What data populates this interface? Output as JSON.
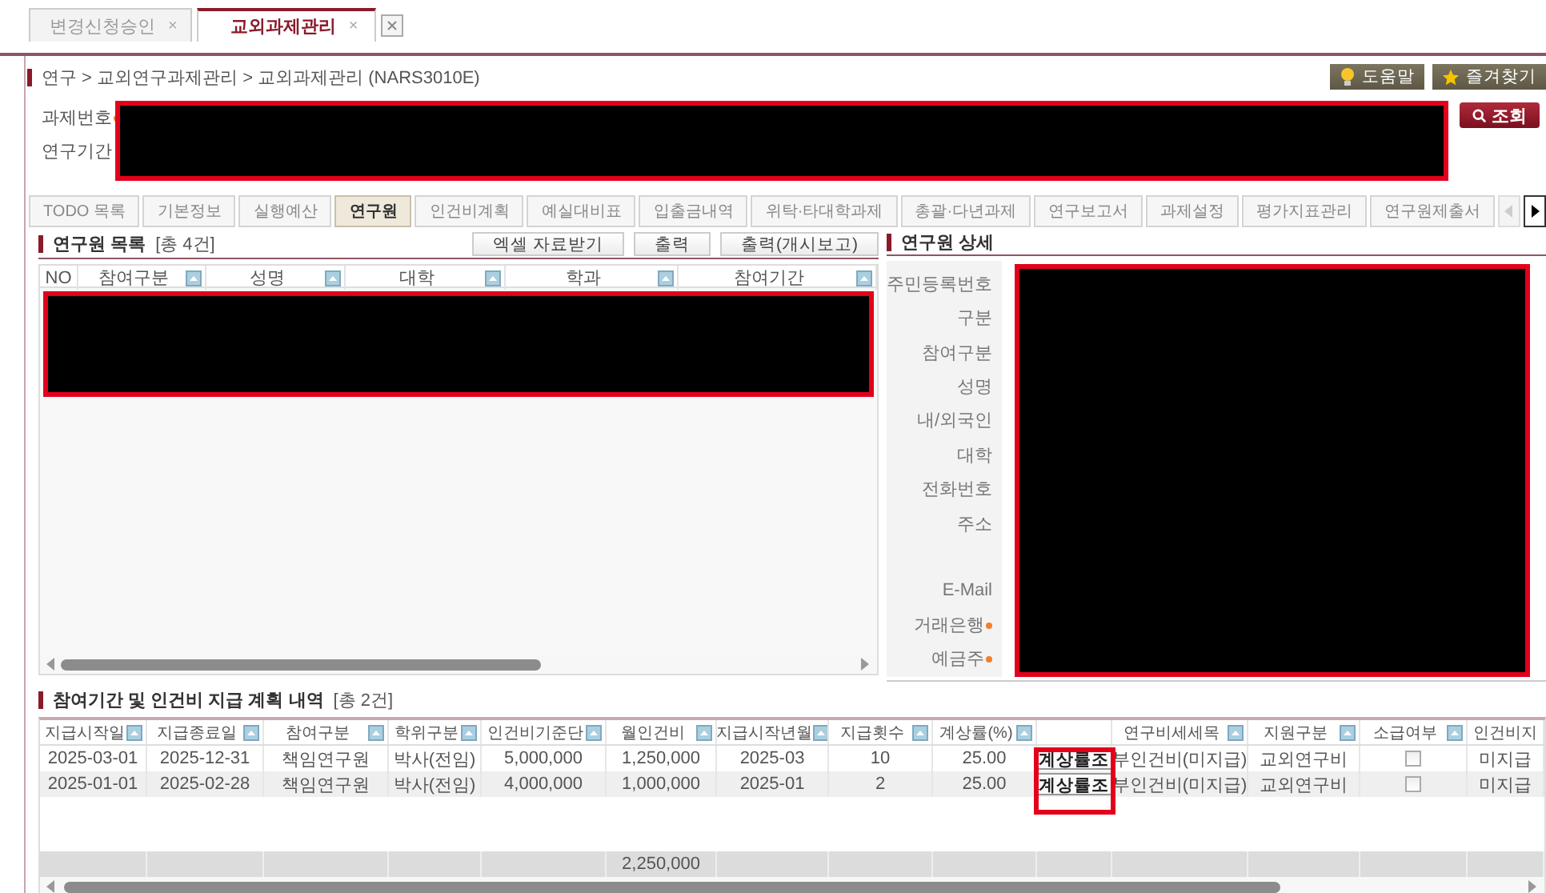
{
  "doc_tabs": [
    {
      "label": "변경신청승인",
      "close": "×",
      "selected": false
    },
    {
      "label": "교외과제관리",
      "close": "×",
      "selected": true
    }
  ],
  "breadcrumb": "연구 > 교외연구과제관리 > 교외과제관리 (NARS3010E)",
  "header_buttons": [
    {
      "kind": "help",
      "label": "도움말"
    },
    {
      "kind": "favorite",
      "label": "즐겨찾기"
    }
  ],
  "search_form": {
    "fields": [
      {
        "label": "과제번호",
        "required": true
      },
      {
        "label": "연구기간",
        "required": false
      }
    ],
    "search_button": "조회"
  },
  "module_tabs": [
    {
      "label": "TODO 목록",
      "selected": false
    },
    {
      "label": "기본정보",
      "selected": false
    },
    {
      "label": "실행예산",
      "selected": false
    },
    {
      "label": "연구원",
      "selected": true
    },
    {
      "label": "인건비계획",
      "selected": false
    },
    {
      "label": "예실대비표",
      "selected": false
    },
    {
      "label": "입출금내역",
      "selected": false
    },
    {
      "label": "위탁·타대학과제",
      "selected": false
    },
    {
      "label": "총괄·다년과제",
      "selected": false
    },
    {
      "label": "연구보고서",
      "selected": false
    },
    {
      "label": "과제설정",
      "selected": false
    },
    {
      "label": "평가지표관리",
      "selected": false
    },
    {
      "label": "연구원제출서",
      "selected": false
    }
  ],
  "researcher_list": {
    "title": "연구원 목록",
    "count": "[총 4건]",
    "buttons": [
      "엑셀 자료받기",
      "출력",
      "출력(개시보고)"
    ],
    "columns": [
      {
        "label": "NO",
        "sortable": false
      },
      {
        "label": "참여구분",
        "sortable": true
      },
      {
        "label": "성명",
        "sortable": true
      },
      {
        "label": "대학",
        "sortable": true
      },
      {
        "label": "학과",
        "sortable": true
      },
      {
        "label": "참여기간",
        "sortable": true
      }
    ]
  },
  "researcher_detail": {
    "title": "연구원 상세",
    "fields": [
      {
        "label": "주민등록번호",
        "required": false
      },
      {
        "label": "구분",
        "required": false
      },
      {
        "label": "참여구분",
        "required": false
      },
      {
        "label": "성명",
        "required": false
      },
      {
        "label": "내/외국인",
        "required": false
      },
      {
        "label": "대학",
        "required": false
      },
      {
        "label": "전화번호",
        "required": false
      },
      {
        "label": "주소",
        "required": false,
        "kind": "tall"
      },
      {
        "label": "E-Mail",
        "required": false
      },
      {
        "label": "거래은행",
        "required": true
      },
      {
        "label": "예금주",
        "required": true
      }
    ]
  },
  "plan": {
    "title": "참여기간 및 인건비 지급 계획 내역",
    "count": "[총 2건]",
    "columns": [
      {
        "label": "지급시작일",
        "sortable": true
      },
      {
        "label": "지급종료일",
        "sortable": true
      },
      {
        "label": "참여구분",
        "sortable": true
      },
      {
        "label": "학위구분",
        "sortable": true
      },
      {
        "label": "인건비기준단",
        "sortable": true
      },
      {
        "label": "월인건비",
        "sortable": true
      },
      {
        "label": "지급시작년월",
        "sortable": true
      },
      {
        "label": "지급횟수",
        "sortable": true
      },
      {
        "label": "계상률(%)",
        "sortable": true
      },
      {
        "sortable": false
      },
      {
        "label": "연구비세세목",
        "sortable": true
      },
      {
        "label": "지원구분",
        "sortable": true
      },
      {
        "label": "소급여부",
        "sortable": true
      },
      {
        "label": "인건비지",
        "sortable": false
      }
    ],
    "rows": [
      {
        "cells": [
          {
            "kind": "text",
            "text": "2025-03-01"
          },
          {
            "kind": "text",
            "text": "2025-12-31"
          },
          {
            "kind": "text",
            "text": "책임연구원"
          },
          {
            "kind": "text",
            "text": "박사(전임)"
          },
          {
            "kind": "text",
            "text": "5,000,000"
          },
          {
            "kind": "text",
            "text": "1,250,000"
          },
          {
            "kind": "text",
            "text": "2025-03"
          },
          {
            "kind": "text",
            "text": "10"
          },
          {
            "kind": "text",
            "text": "25.00"
          },
          {
            "kind": "button",
            "text": "계상률조"
          },
          {
            "kind": "text",
            "text": "부인건비(미지급)"
          },
          {
            "kind": "text",
            "text": "교외연구비"
          },
          {
            "kind": "checkbox",
            "checked": false
          },
          {
            "kind": "text",
            "text": "미지급"
          }
        ]
      },
      {
        "cells": [
          {
            "kind": "text",
            "text": "2025-01-01"
          },
          {
            "kind": "text",
            "text": "2025-02-28"
          },
          {
            "kind": "text",
            "text": "책임연구원"
          },
          {
            "kind": "text",
            "text": "박사(전임)"
          },
          {
            "kind": "text",
            "text": "4,000,000"
          },
          {
            "kind": "text",
            "text": "1,000,000"
          },
          {
            "kind": "text",
            "text": "2025-01"
          },
          {
            "kind": "text",
            "text": "2"
          },
          {
            "kind": "text",
            "text": "25.00"
          },
          {
            "kind": "button",
            "text": "계상률조"
          },
          {
            "kind": "text",
            "text": "부인건비(미지급)"
          },
          {
            "kind": "text",
            "text": "교외연구비"
          },
          {
            "kind": "checkbox",
            "checked": false
          },
          {
            "kind": "text",
            "text": "미지급"
          }
        ]
      }
    ],
    "total_row": {
      "monthly_cost": "2,250,000"
    }
  }
}
